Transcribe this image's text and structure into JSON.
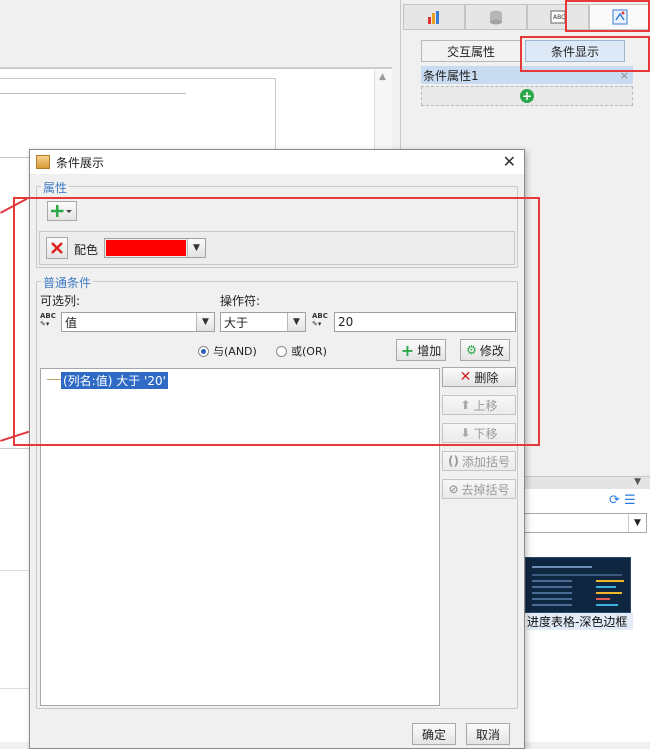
{
  "right_panel": {
    "subtabs": [
      "交互属性",
      "条件显示"
    ],
    "condition_attr_item": "条件属性1",
    "condition_attr_delete": "×",
    "add_condition": "+",
    "template_thumb_label": "进度表格-深色边框"
  },
  "dialog": {
    "title": "条件展示",
    "close": "✕",
    "attr_group_title": "属性",
    "add_attr_icon": "plus-dropdown-icon",
    "attr_item_label": "配色",
    "attr_item_color": "#ff0000",
    "cond_group_title": "普通条件",
    "column_label": "可选列:",
    "column_value": "值",
    "operator_label": "操作符:",
    "operator_value": "大于",
    "compare_value": "20",
    "radio_and": "与(AND)",
    "radio_or": "或(OR)",
    "btn_add": "增加",
    "btn_modify": "修改",
    "btn_delete": "删除",
    "btn_up": "上移",
    "btn_down": "下移",
    "btn_add_paren": "添加括号",
    "btn_remove_paren": "去掉括号",
    "condition_item": "(列名:值) 大于 '20'",
    "btn_ok": "确定",
    "btn_cancel": "取消"
  },
  "colors": {
    "accent_blue": "#2f6bc4",
    "annotation_red": "#e53a3a",
    "group_title_blue": "#3f7bc3"
  }
}
